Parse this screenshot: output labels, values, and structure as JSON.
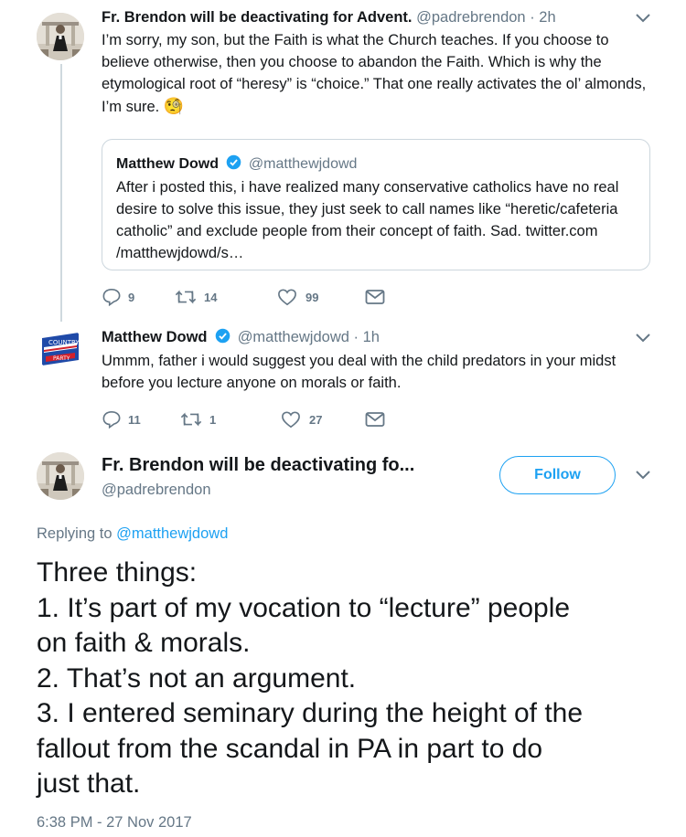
{
  "tweet1": {
    "display_name": "Fr. Brendon will be deactivating for Advent.",
    "handle": "@padrebrendon",
    "time": "· 2h",
    "text": "I’m sorry, my son, but the Faith is what the Church teaches. If you choose to believe otherwise, then you choose to abandon the Faith. Which is why the etymological root of “heresy” is “choice.” That one really activates the ol’ almonds, I’m sure.",
    "emoji": "🧐",
    "quote": {
      "display_name": "Matthew Dowd",
      "handle": "@matthewjdowd",
      "text": "After i posted this, i have realized many conservative catholics have no real desire to solve this issue, they just seek to call names like “heretic/cafeteria catholic” and exclude people from their concept of faith. Sad. twitter.com /matthewjdowd/s…"
    },
    "actions": {
      "replies": "9",
      "retweets": "14",
      "likes": "99"
    }
  },
  "tweet2": {
    "display_name": "Matthew Dowd",
    "handle": "@matthewjdowd",
    "time": "· 1h",
    "text": "Ummm, father i would suggest you deal with the child predators in your midst before you lecture anyone on morals or faith.",
    "actions": {
      "replies": "11",
      "retweets": "1",
      "likes": "27"
    }
  },
  "main_tweet": {
    "display_name": "Fr. Brendon will be deactivating fo...",
    "handle": "@padrebrendon",
    "follow_label": "Follow",
    "replying_prefix": "Replying to",
    "replying_handle": "@matthewjdowd",
    "lines": [
      "Three things:",
      "1. It’s part of my vocation to “lecture” people",
      "on faith & morals.",
      "2. That’s not an argument.",
      "3. I entered seminary during the height of the",
      "fallout from the scandal in PA in part to do",
      "just that."
    ],
    "timestamp": "6:38 PM - 27 Nov 2017"
  },
  "colors": {
    "accent": "#1da1f2",
    "text": "#14171a",
    "muted": "#657786",
    "border": "#ccd6dd"
  }
}
